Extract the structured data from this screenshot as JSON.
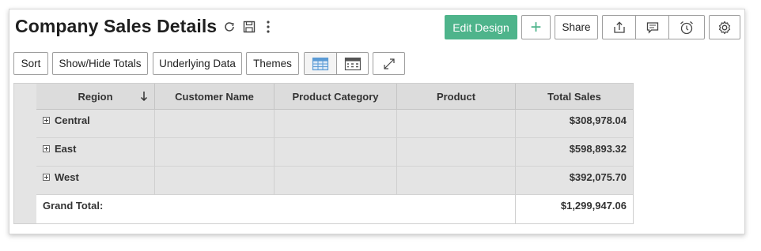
{
  "report": {
    "title": "Company Sales Details"
  },
  "actions": {
    "edit_design": "Edit Design",
    "add": "+",
    "share": "Share"
  },
  "toolbar": {
    "sort": "Sort",
    "show_hide_totals": "Show/Hide Totals",
    "underlying_data": "Underlying Data",
    "themes": "Themes"
  },
  "table": {
    "columns": [
      "Region",
      "Customer Name",
      "Product Category",
      "Product",
      "Total Sales"
    ],
    "rows": [
      {
        "region": "Central",
        "total": "$308,978.04"
      },
      {
        "region": "East",
        "total": "$598,893.32"
      },
      {
        "region": "West",
        "total": "$392,075.70"
      }
    ],
    "grand_total_label": "Grand Total:",
    "grand_total": "$1,299,947.06"
  },
  "colors": {
    "accent": "#4eb48b",
    "header_bg": "#dcdcdc",
    "row_bg": "#e4e4e4"
  },
  "icons": [
    "refresh-icon",
    "save-icon",
    "more-vertical-icon",
    "export-icon",
    "comment-icon",
    "alarm-icon",
    "settings-icon",
    "pivot-view-icon",
    "table-view-icon",
    "fullscreen-icon",
    "sort-down-icon",
    "expand-icon"
  ]
}
